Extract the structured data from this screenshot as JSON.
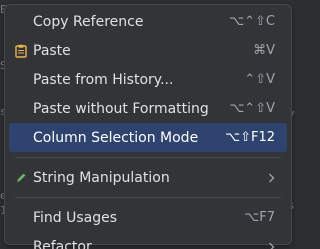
{
  "context_menu": {
    "items": [
      {
        "label": "Copy Reference",
        "shortcut": "⌥⌃⇧C",
        "icon": "none"
      },
      {
        "label": "Paste",
        "shortcut": "⌘V",
        "icon": "clipboard-icon"
      },
      {
        "label": "Paste from History...",
        "shortcut": "⌃⇧V",
        "icon": "none"
      },
      {
        "label": "Paste without Formatting",
        "shortcut": "⌥⌃⇧V",
        "icon": "none"
      },
      {
        "label": "Column Selection Mode",
        "shortcut": "⌥⇧F12",
        "icon": "none",
        "selected": true
      },
      {
        "label": "String Manipulation",
        "shortcut": "",
        "icon": "pencil-icon",
        "submenu": true
      },
      {
        "label": "Find Usages",
        "shortcut": "⌥F7",
        "icon": "none"
      },
      {
        "label": "Refactor",
        "shortcut": "",
        "icon": "none",
        "submenu": true
      }
    ]
  },
  "colors": {
    "selection": "#2e436e",
    "menu_background": "#323438",
    "clipboard_icon": "#e8b54a",
    "pencil_icon": "#6fb86b"
  }
}
